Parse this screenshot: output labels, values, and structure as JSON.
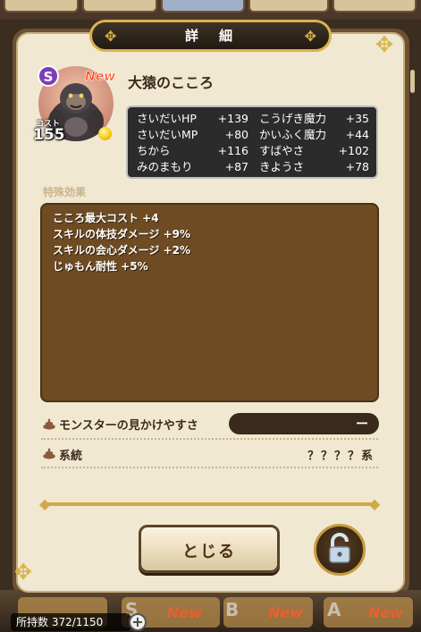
{
  "title": "詳　細",
  "heart": {
    "rank": "S",
    "new_badge": "New",
    "name": "大猿のこころ",
    "cost_label": "コスト",
    "cost": "155"
  },
  "stats": [
    {
      "name": "さいだいHP",
      "value": "+139"
    },
    {
      "name": "さいだいMP",
      "value": "+80"
    },
    {
      "name": "ちから",
      "value": "+116"
    },
    {
      "name": "みのまもり",
      "value": "+87"
    },
    {
      "name": "こうげき魔力",
      "value": "+35"
    },
    {
      "name": "かいふく魔力",
      "value": "+44"
    },
    {
      "name": "すばやさ",
      "value": "+102"
    },
    {
      "name": "きようさ",
      "value": "+78"
    }
  ],
  "effects_label": "特殊効果",
  "effects": [
    "こころ最大コスト +4",
    "スキルの体技ダメージ +9%",
    "スキルの会心ダメージ +2%",
    "じゅもん耐性 +5%"
  ],
  "visibility": {
    "label": "モンスターの見かけやすさ",
    "value": "ー"
  },
  "lineage": {
    "label": "系統",
    "value": "？？？？系"
  },
  "close_label": "とじる",
  "background": {
    "inventory_count": "所持数 372/1150",
    "plus_icon": "+",
    "card_badges": [
      "New",
      "New",
      "New"
    ],
    "card_ranks": [
      "S",
      "B",
      "A"
    ]
  },
  "colors": {
    "panel": "#f1e8d2",
    "frame": "#6b5034",
    "gold": "#d9b24d",
    "effects_box": "#6e4b23",
    "new_badge": "#ff4b22"
  }
}
